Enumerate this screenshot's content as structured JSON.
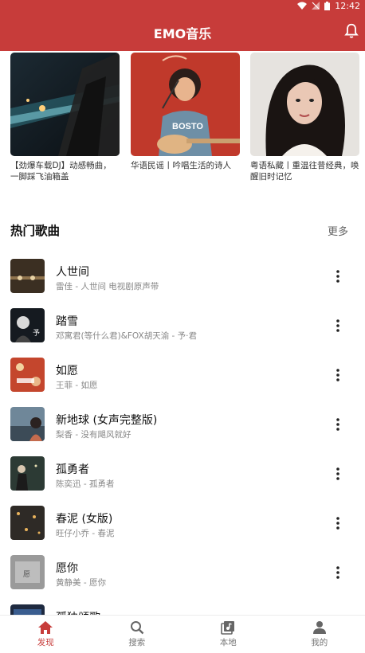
{
  "status": {
    "time": "12:42"
  },
  "header": {
    "title": "EMO音乐"
  },
  "playlists": [
    {
      "title": "【劲爆车载DJ】动感畅曲，一脚踩飞油箱盖"
    },
    {
      "title": "华语民谣丨吟唱生活的诗人"
    },
    {
      "title": "粤语私藏丨重温往昔经典，唤醒旧时记忆"
    }
  ],
  "hot_songs": {
    "title": "热门歌曲",
    "more_label": "更多",
    "items": [
      {
        "title": "人世间",
        "subtitle": "雷佳 - 人世间 电视剧原声带"
      },
      {
        "title": "踏雪",
        "subtitle": "邓寓君(等什么君)&FOX胡天渝 - 予·君"
      },
      {
        "title": "如愿",
        "subtitle": "王菲 - 如愿"
      },
      {
        "title": "新地球 (女声完整版)",
        "subtitle": "梨香 - 没有飓风就好"
      },
      {
        "title": "孤勇者",
        "subtitle": "陈奕迅 - 孤勇者"
      },
      {
        "title": "春泥 (女版)",
        "subtitle": "旺仔小乔 - 春泥"
      },
      {
        "title": "愿你",
        "subtitle": "黄静美 - 愿你"
      },
      {
        "title": "孤独颂歌",
        "subtitle": ""
      }
    ]
  },
  "nav": [
    {
      "label": "发现",
      "icon": "home-icon",
      "active": true
    },
    {
      "label": "搜索",
      "icon": "search-icon",
      "active": false
    },
    {
      "label": "本地",
      "icon": "music-library-icon",
      "active": false
    },
    {
      "label": "我的",
      "icon": "person-icon",
      "active": false
    }
  ],
  "colors": {
    "accent": "#c73c3a"
  }
}
